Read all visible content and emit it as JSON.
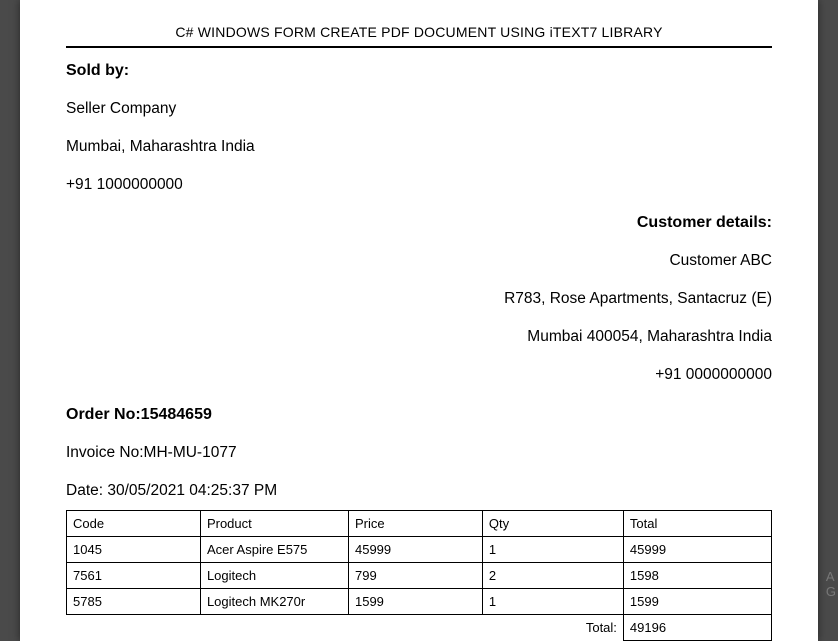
{
  "title": "C# WINDOWS FORM CREATE PDF DOCUMENT USING iTEXT7 LIBRARY",
  "soldBy": {
    "label": "Sold by:",
    "company": "Seller Company",
    "address": "Mumbai, Maharashtra India",
    "phone": "+91 1000000000"
  },
  "customer": {
    "label": "Customer details:",
    "name": "Customer ABC",
    "address1": "R783, Rose Apartments, Santacruz (E)",
    "address2": "Mumbai 400054, Maharashtra India",
    "phone": "+91 0000000000"
  },
  "order": {
    "orderNoLabel": "Order No:",
    "orderNo": "15484659",
    "invoiceLabel": "Invoice No:",
    "invoiceNo": "MH-MU-1077",
    "dateLabel": "Date: ",
    "date": "30/05/2021 04:25:37 PM"
  },
  "table": {
    "headers": {
      "code": "Code",
      "product": "Product",
      "price": "Price",
      "qty": "Qty",
      "total": "Total"
    },
    "rows": [
      {
        "code": "1045",
        "product": "Acer Aspire E575",
        "price": "45999",
        "qty": "1",
        "total": "45999"
      },
      {
        "code": "7561",
        "product": "Logitech",
        "price": "799",
        "qty": "2",
        "total": "1598"
      },
      {
        "code": "5785",
        "product": "Logitech MK270r",
        "price": "1599",
        "qty": "1",
        "total": "1599"
      }
    ],
    "totalLabel": "Total:",
    "totalValue": "49196"
  },
  "watermark": {
    "line1": "A",
    "line2": "G"
  }
}
